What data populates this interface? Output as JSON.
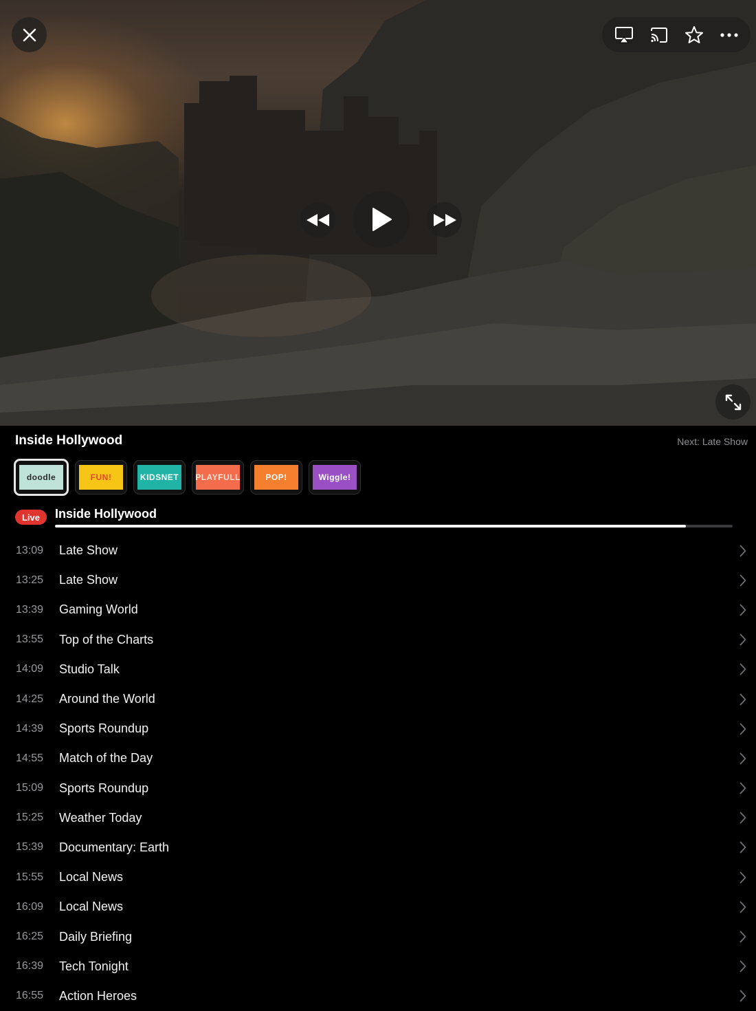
{
  "player": {
    "controls": {
      "close_icon": "close-icon",
      "airplay_icon": "airplay-icon",
      "cast_icon": "cast-icon",
      "favorite_icon": "star-icon",
      "more_icon": "more-icon",
      "rewind_icon": "rewind-icon",
      "play_icon": "play-icon",
      "fast_forward_icon": "fast-forward-icon",
      "fullscreen_icon": "expand-icon"
    }
  },
  "now": {
    "title": "Inside Hollywood",
    "next_label": "Next: Late Show"
  },
  "channels": [
    {
      "name": "doodle",
      "bg": "#bfe3d9",
      "fg": "#2b2b2b",
      "selected": true
    },
    {
      "name": "FUN!",
      "bg": "#f6c515",
      "fg": "#e8472c",
      "selected": false
    },
    {
      "name": "KIDSNET",
      "bg": "#1fb4a6",
      "fg": "#ffffff",
      "selected": false
    },
    {
      "name": "PLAYFULL",
      "bg": "#f36c4c",
      "fg": "#ffe3d4",
      "selected": false
    },
    {
      "name": "POP!",
      "bg": "#f57f2f",
      "fg": "#ffffff",
      "selected": false
    },
    {
      "name": "Wiggle!",
      "bg": "#9a4fc4",
      "fg": "#ffffff",
      "selected": false
    }
  ],
  "live": {
    "badge": "Live",
    "title": "Inside Hollywood",
    "progress": 0.931
  },
  "schedule": [
    {
      "time": "13:09",
      "title": "Late Show"
    },
    {
      "time": "13:25",
      "title": "Late Show"
    },
    {
      "time": "13:39",
      "title": "Gaming World"
    },
    {
      "time": "13:55",
      "title": "Top of the Charts"
    },
    {
      "time": "14:09",
      "title": "Studio Talk"
    },
    {
      "time": "14:25",
      "title": "Around the World"
    },
    {
      "time": "14:39",
      "title": "Sports Roundup"
    },
    {
      "time": "14:55",
      "title": "Match of the Day"
    },
    {
      "time": "15:09",
      "title": "Sports Roundup"
    },
    {
      "time": "15:25",
      "title": "Weather Today"
    },
    {
      "time": "15:39",
      "title": "Documentary: Earth"
    },
    {
      "time": "15:55",
      "title": "Local News"
    },
    {
      "time": "16:09",
      "title": "Local News"
    },
    {
      "time": "16:25",
      "title": "Daily Briefing"
    },
    {
      "time": "16:39",
      "title": "Tech Tonight"
    },
    {
      "time": "16:55",
      "title": "Action Heroes"
    }
  ],
  "colors": {
    "live_badge": "#e0342f",
    "progress_fill": "#ffffff",
    "progress_track": "#3a3a3c"
  }
}
